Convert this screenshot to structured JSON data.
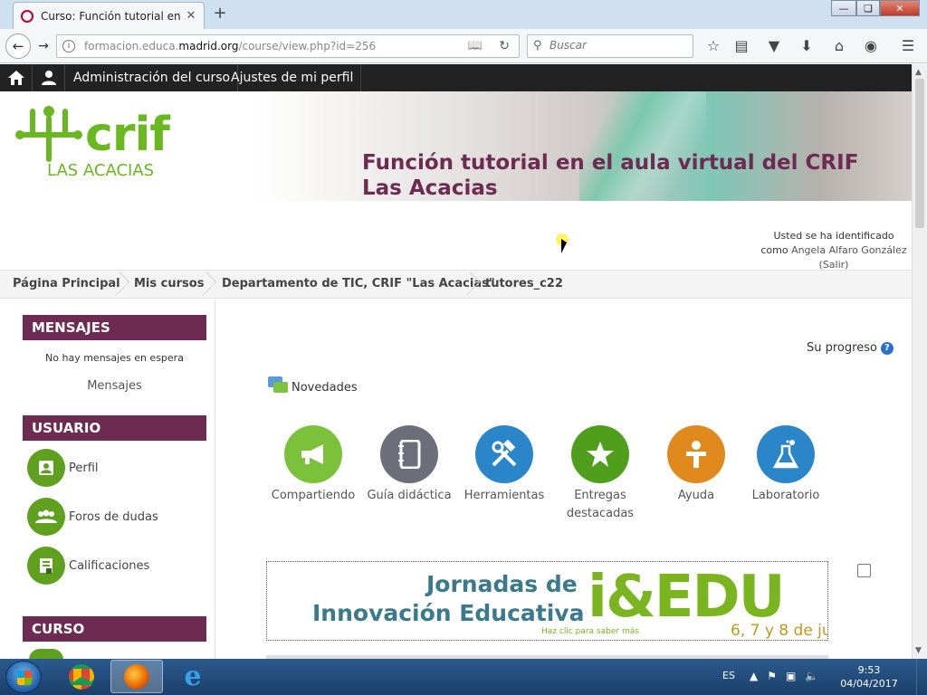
{
  "browser": {
    "tab_title": "Curso: Función tutorial en ...",
    "tab_close": "✕",
    "new_tab": "+",
    "url_prefix": "formacion.educa.",
    "url_domain": "madrid.org",
    "url_path": "/course/view.php?id=256",
    "search_placeholder": "Buscar"
  },
  "topnav": {
    "items": [
      "Administración del curso",
      "Ajustes de mi perfil"
    ]
  },
  "header": {
    "logo_main": "crif",
    "logo_sub": "LAS ACACIAS",
    "title": "Función tutorial en el aula virtual del CRIF Las Acacias"
  },
  "login": {
    "line1": "Usted se ha identificado",
    "como": "como",
    "user": "Angela Alfaro González",
    "logout": "(Salir)"
  },
  "breadcrumb": [
    "Página Principal",
    "Mis cursos",
    "Departamento de TIC, CRIF \"Las Acacias\"",
    "tutores_c22"
  ],
  "sidebar": {
    "mensajes_title": "MENSAJES",
    "no_messages": "No hay mensajes en espera",
    "messages_link": "Mensajes",
    "usuario_title": "USUARIO",
    "usuario_items": [
      "Perfil",
      "Foros de dudas",
      "Calificaciones"
    ],
    "curso_title": "CURSO"
  },
  "main": {
    "progress": "Su progreso",
    "progress_help": "?",
    "novedades": "Novedades",
    "tiles": [
      {
        "label": "Compartiendo",
        "color": "#7cc13a"
      },
      {
        "label": "Guía didáctica",
        "color": "#6c6f7a"
      },
      {
        "label": "Herramientas",
        "color": "#2b86c9"
      },
      {
        "label": "Entregas destacadas",
        "color": "#4f9e1c"
      },
      {
        "label": "Ayuda",
        "color": "#e08a1e"
      },
      {
        "label": "Laboratorio",
        "color": "#2b86c9"
      }
    ],
    "banner": {
      "line1": "Jornadas de",
      "line2": "Innovación Educativa",
      "big": "i&EDU",
      "hint": "Haz clic para saber más",
      "date": "6, 7 y 8 de ju"
    }
  },
  "taskbar": {
    "lang": "ES",
    "time": "9:53",
    "date": "04/04/2017"
  }
}
